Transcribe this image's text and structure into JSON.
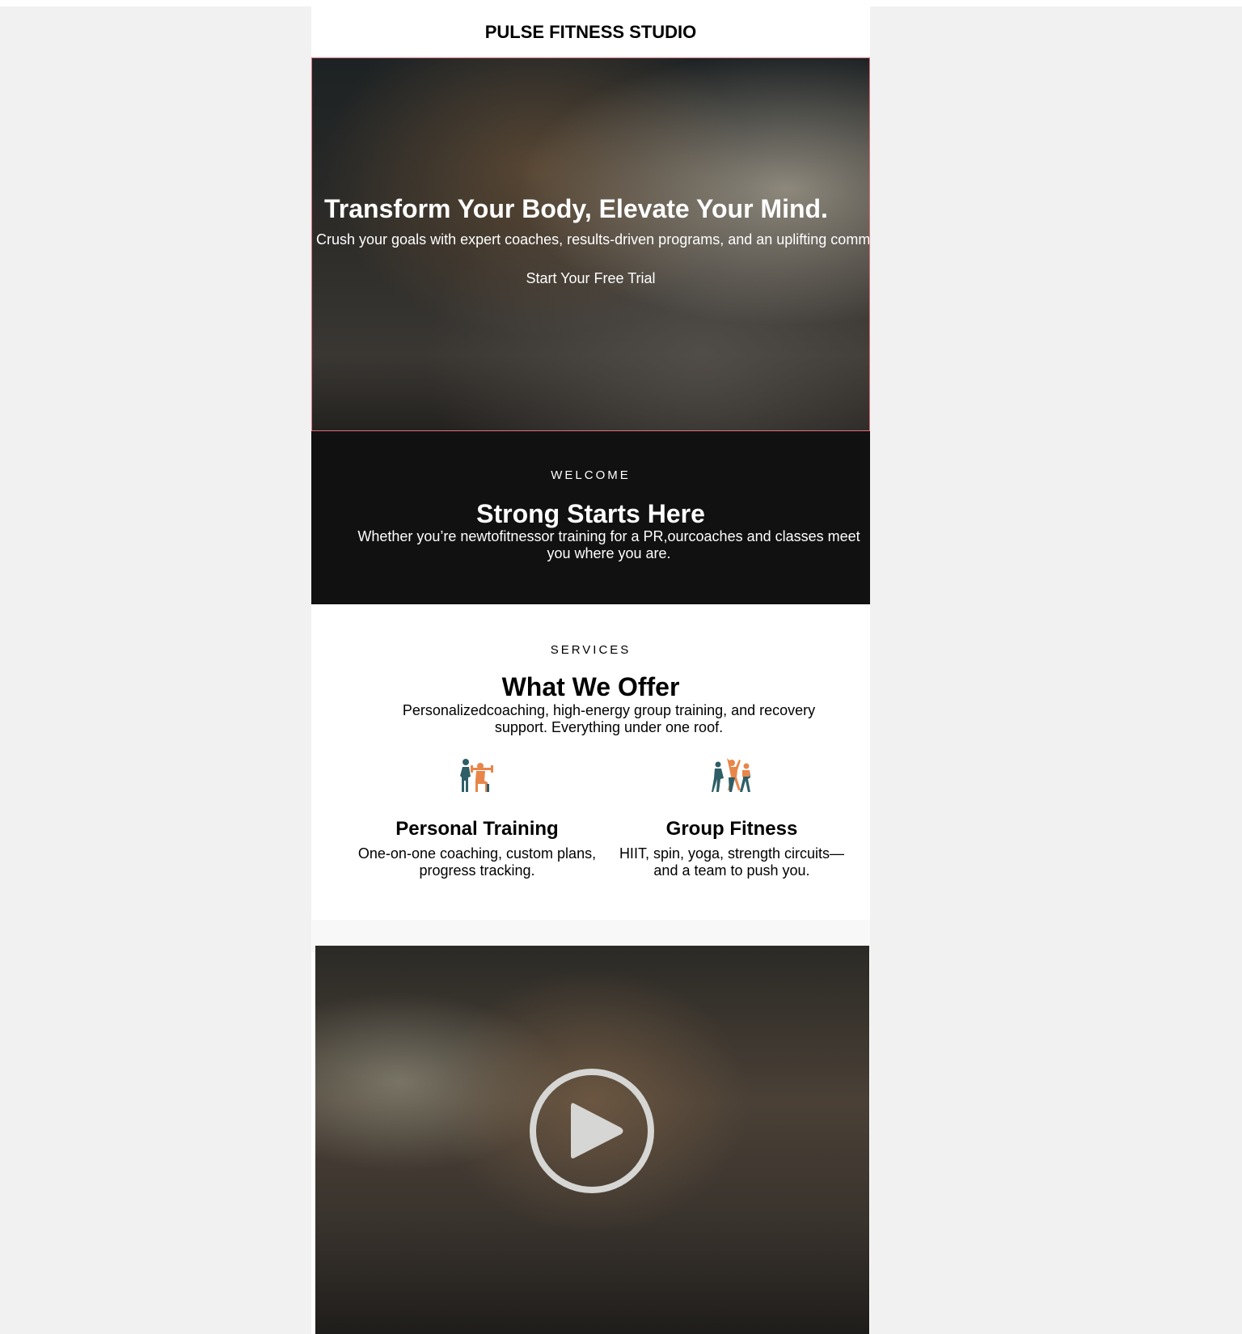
{
  "brand": "PULSE FITNESS STUDIO",
  "hero": {
    "title": "Transform Your Body, Elevate Your Mind.",
    "subtitle": "Crush your goals with expert coaches, results-driven programs, and an uplifting community.",
    "cta": "Start Your Free Trial"
  },
  "welcome": {
    "eyebrow": "WELCOME",
    "title": "Strong Starts Here",
    "body": "Whether you’re newtofitnessor training for a PR,ourcoaches and classes meet you where you are."
  },
  "services": {
    "eyebrow": "SERVICES",
    "title": "What We Offer",
    "intro": "Personalizedcoaching, high-energy group training, and recovery support. Everything under one roof.",
    "items": [
      {
        "icon": "personal-training-icon",
        "title": "Personal Training",
        "body": "One-on-one coaching, custom plans, progress tracking."
      },
      {
        "icon": "group-fitness-icon",
        "title": "Group Fitness",
        "body": "HIIT, spin, yoga, strength circuits—and a team to push you."
      }
    ]
  },
  "colors": {
    "teal": "#2e5e66",
    "orange": "#e8864a",
    "dark": "#111111"
  }
}
